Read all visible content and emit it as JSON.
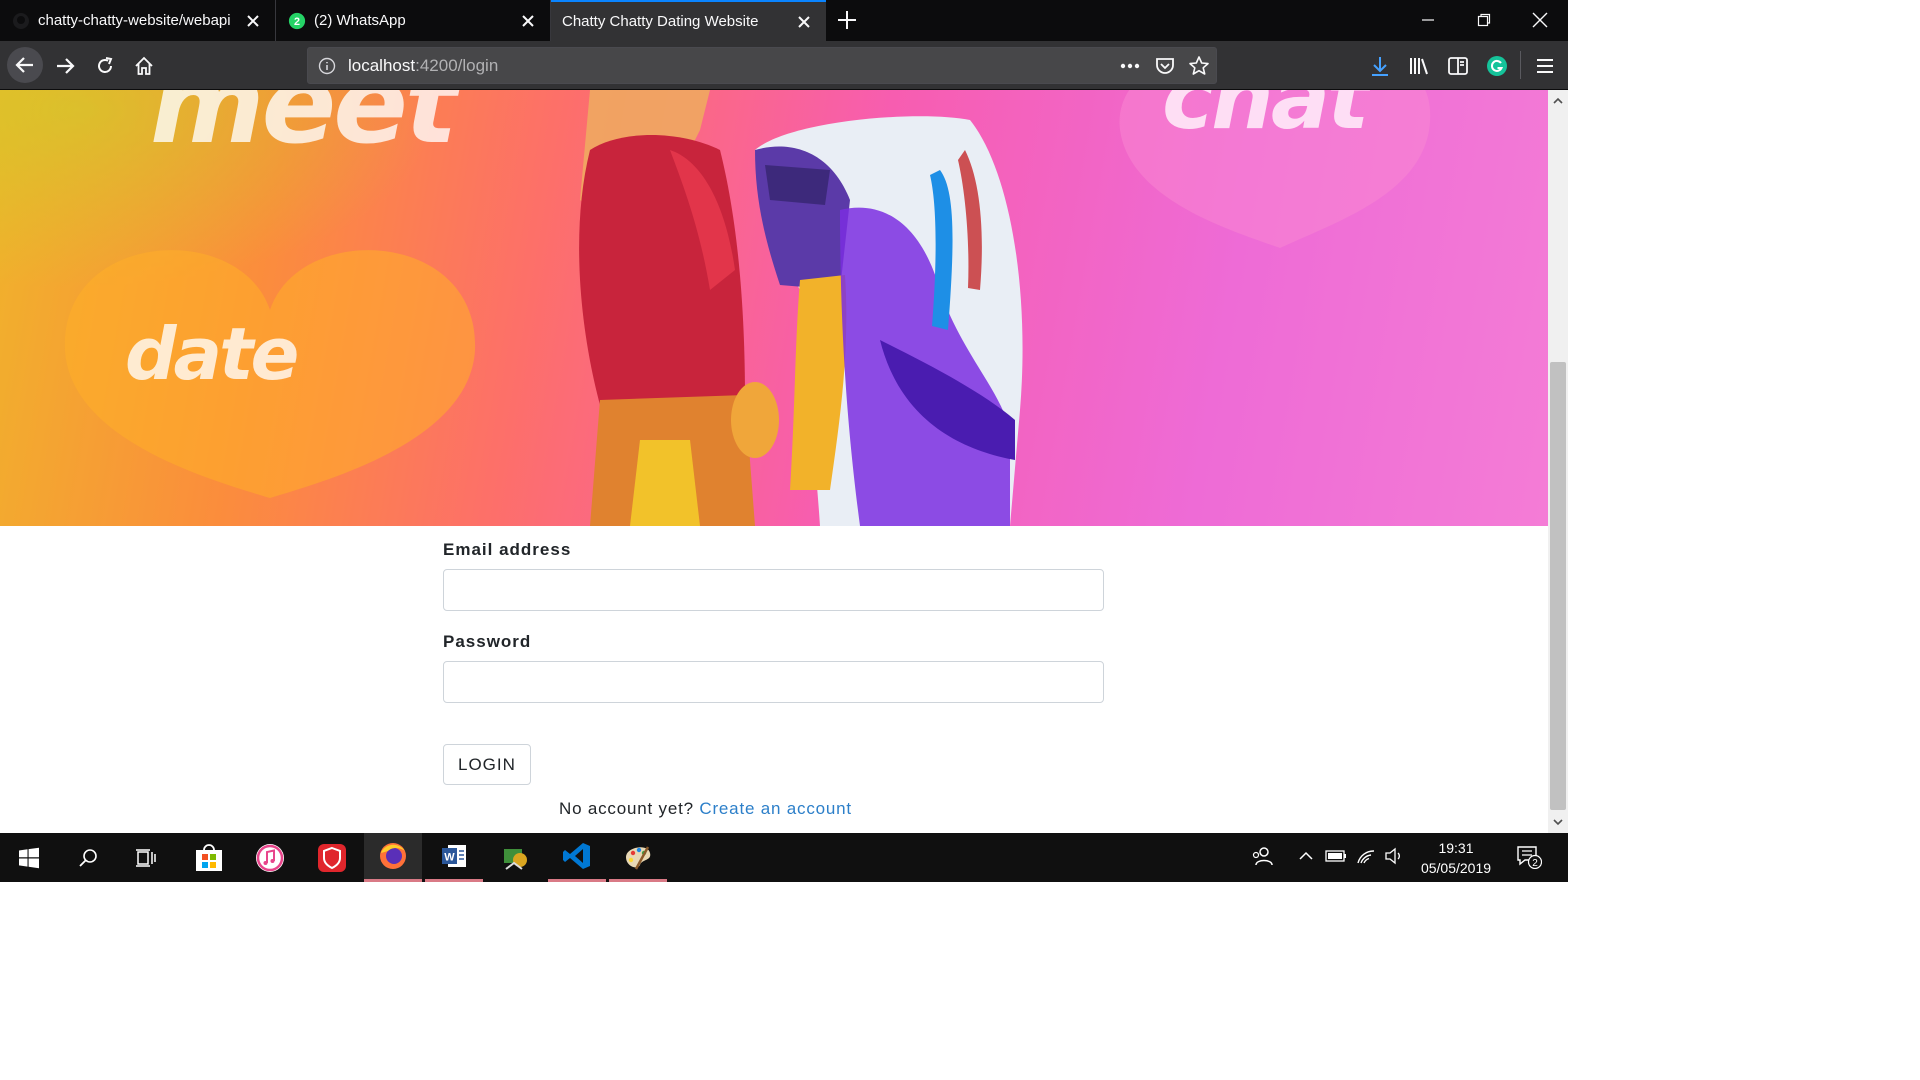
{
  "browser": {
    "tabs": [
      {
        "label": "chatty-chatty-website/webapi",
        "favicon": "github-icon",
        "active": false
      },
      {
        "label": "(2) WhatsApp",
        "favicon": "whatsapp-icon",
        "badge": "2",
        "active": false
      },
      {
        "label": "Chatty Chatty Dating Website",
        "favicon": "none",
        "active": true
      }
    ],
    "url": {
      "host": "localhost",
      "rest": ":4200/login"
    }
  },
  "hero": {
    "words": {
      "meet": "meet",
      "chat": "chat",
      "date": "date"
    }
  },
  "login_form": {
    "email_label": "Email address",
    "email_value": "",
    "password_label": "Password",
    "password_value": "",
    "login_button": "LOGIN",
    "no_account_text": "No account yet?",
    "create_account_link": "Create an account"
  },
  "taskbar": {
    "apps": [
      "start-icon",
      "search-icon",
      "task-view-icon",
      "store-icon",
      "itunes-icon",
      "security-icon",
      "firefox-icon",
      "word-icon",
      "network-app-icon",
      "vscode-icon",
      "paint-icon"
    ],
    "time": "19:31",
    "date": "05/05/2019",
    "notification_count": "2"
  },
  "colors": {
    "accent": "#0a84ff",
    "link": "#2c7fc9",
    "taskbar_indicator": "#d97a86"
  }
}
